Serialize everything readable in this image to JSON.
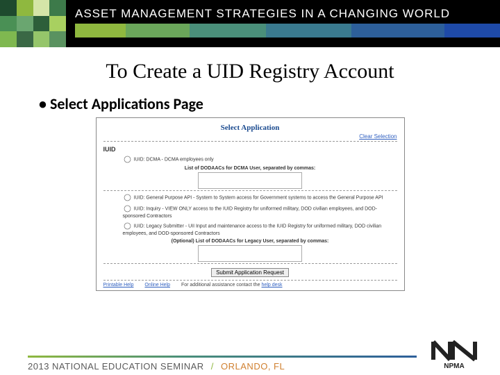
{
  "header": {
    "title": "ASSET MANAGEMENT STRATEGIES IN A CHANGING WORLD"
  },
  "slide": {
    "title": "To Create a UID Registry Account",
    "bullet": "Select Applications Page"
  },
  "app_screenshot": {
    "title": "Select Application",
    "clear_link": "Clear Selection",
    "section_label": "IUID",
    "options": [
      "IUID: DCMA - DCMA employees only",
      "IUID: General Purpose API - System to System access for Government systems to access the General Purpose API",
      "IUID: Inquiry - VIEW ONLY access to the IUID Registry for uniformed military, DOD civilian employees, and DOD-sponsored Contractors",
      "IUID: Legacy Submitter - UII Input and maintenance access to the IUID Registry for uniformed military, DOD civilian employees, and DOD-sponsored Contractors"
    ],
    "dcma_list_label": "List of DODAACs for DCMA User, separated by commas:",
    "legacy_list_label": "(Optional) List of DODAACs for Legacy User, separated by commas:",
    "submit_label": "Submit Application Request",
    "help": {
      "printable": "Printable Help",
      "online": "Online Help",
      "assist_prefix": "For additional assistance contact the ",
      "assist_link": "help desk"
    }
  },
  "footer": {
    "event": "2013 NATIONAL EDUCATION SEMINAR",
    "location": "ORLANDO, FL",
    "logo_text": "NPMA"
  }
}
